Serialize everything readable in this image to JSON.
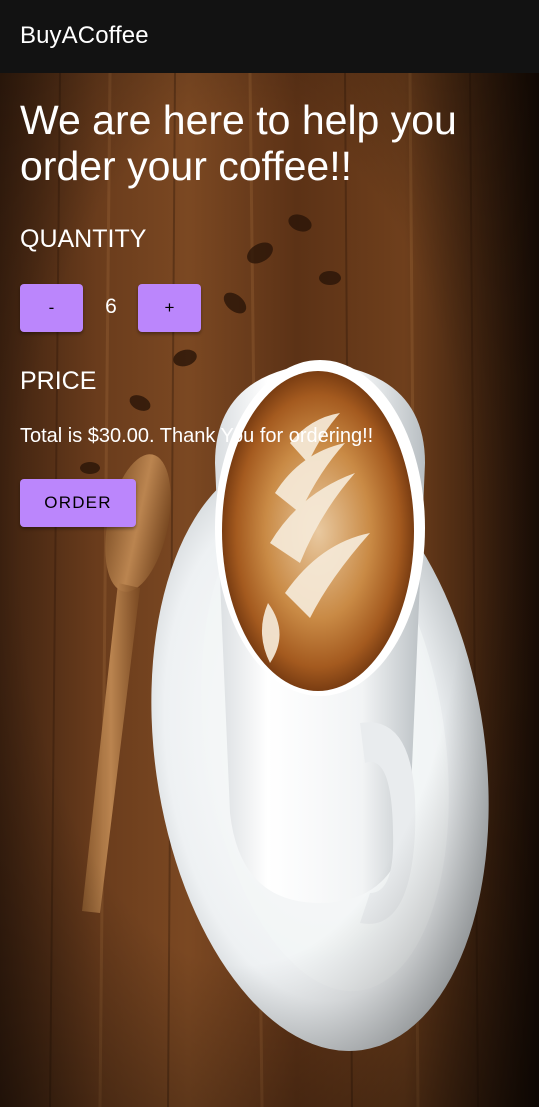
{
  "app_bar": {
    "title": "BuyACoffee"
  },
  "main": {
    "headline": "We are here to help you order your coffee!!",
    "quantity_label": "QUANTITY",
    "decrement_label": "-",
    "quantity_value": "6",
    "increment_label": "+",
    "price_label": "PRICE",
    "summary": "Total is $30.00. Thank You for ordering!!",
    "order_label": "ORDER"
  },
  "background": {
    "subject": "coffee-cup-latte-art-photo"
  },
  "colors": {
    "app_bar": "#121212",
    "button": "#bb86fc",
    "text": "#ffffff"
  }
}
